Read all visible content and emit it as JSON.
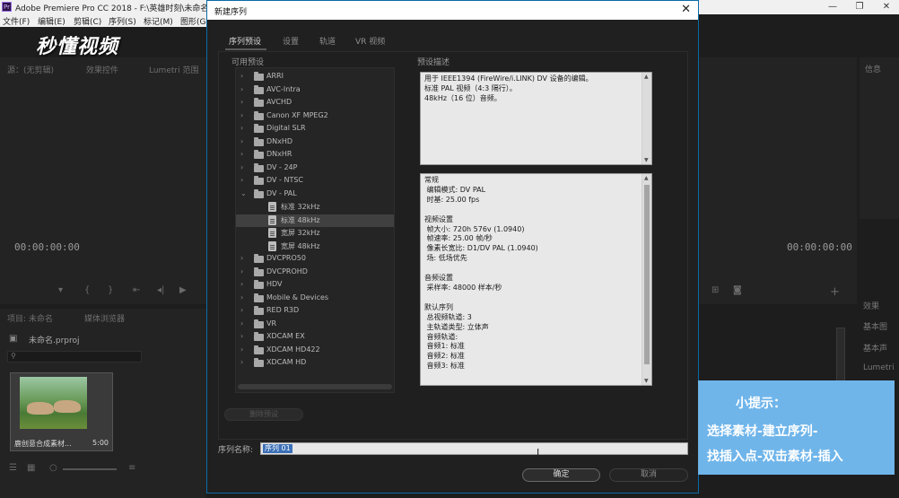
{
  "app": {
    "title": "Adobe Premiere Pro CC 2018 - F:\\英雄时刻\\未命名",
    "logo": "Pr",
    "menu": [
      "文件(F)",
      "编辑(E)",
      "剪辑(C)",
      "序列(S)",
      "标记(M)",
      "图形(G"
    ],
    "window_controls": [
      "—",
      "❐",
      "✕"
    ]
  },
  "watermark": "秒懂视频",
  "left_panels": {
    "source_tab": "源：(无剪辑)",
    "effects_tab": "效果控件",
    "lumetri_tab": "Lumetri 范围",
    "timecode_left": "00:00:00:00",
    "timecode_right": "00:00:00:00",
    "project_tab": "项目: 未命名",
    "media_browser_tab": "媒体浏览器",
    "project_file": "未命名.prproj",
    "clip_name": "鹿创意合成素材...",
    "clip_duration": "5:00"
  },
  "right_panels": {
    "items": [
      "信息",
      "效果",
      "基本图",
      "基本声",
      "Lumetri"
    ]
  },
  "dialog": {
    "title": "新建序列",
    "close": "✕",
    "tabs": [
      "序列预设",
      "设置",
      "轨道",
      "VR 视频"
    ],
    "available_presets_label": "可用预设",
    "preset_desc_label": "预设描述",
    "tree": [
      {
        "label": "ARRI",
        "type": "folder",
        "expanded": false
      },
      {
        "label": "AVC-Intra",
        "type": "folder",
        "expanded": false
      },
      {
        "label": "AVCHD",
        "type": "folder",
        "expanded": false
      },
      {
        "label": "Canon XF MPEG2",
        "type": "folder",
        "expanded": false
      },
      {
        "label": "Digital SLR",
        "type": "folder",
        "expanded": false
      },
      {
        "label": "DNxHD",
        "type": "folder",
        "expanded": false
      },
      {
        "label": "DNxHR",
        "type": "folder",
        "expanded": false
      },
      {
        "label": "DV - 24P",
        "type": "folder",
        "expanded": false
      },
      {
        "label": "DV - NTSC",
        "type": "folder",
        "expanded": false
      },
      {
        "label": "DV - PAL",
        "type": "folder",
        "expanded": true
      },
      {
        "label": "标准 32kHz",
        "type": "file"
      },
      {
        "label": "标准 48kHz",
        "type": "file",
        "selected": true
      },
      {
        "label": "宽屏 32kHz",
        "type": "file"
      },
      {
        "label": "宽屏 48kHz",
        "type": "file"
      },
      {
        "label": "DVCPRO50",
        "type": "folder",
        "expanded": false
      },
      {
        "label": "DVCPROHD",
        "type": "folder",
        "expanded": false
      },
      {
        "label": "HDV",
        "type": "folder",
        "expanded": false
      },
      {
        "label": "Mobile & Devices",
        "type": "folder",
        "expanded": false
      },
      {
        "label": "RED R3D",
        "type": "folder",
        "expanded": false
      },
      {
        "label": "VR",
        "type": "folder",
        "expanded": false
      },
      {
        "label": "XDCAM EX",
        "type": "folder",
        "expanded": false
      },
      {
        "label": "XDCAM HD422",
        "type": "folder",
        "expanded": false
      },
      {
        "label": "XDCAM HD",
        "type": "folder",
        "expanded": false
      }
    ],
    "description": "用于 IEEE1394 (FireWire/i.LINK) DV 设备的编辑。\n标准 PAL 视频（4:3 隔行）。\n48kHz（16 位）音频。",
    "details": "常规\n 编辑模式: DV PAL\n 时基: 25.00 fps\n\n视频设置\n 帧大小: 720h 576v (1.0940)\n 帧速率: 25.00 帧/秒\n 像素长宽比: D1/DV PAL (1.0940)\n 场: 低场优先\n\n音频设置\n 采样率: 48000 样本/秒\n\n默认序列\n 总视频轨道: 3\n 主轨道类型: 立体声\n 音频轨道:\n 音频1: 标准\n 音频2: 标准\n 音频3: 标准",
    "delete_preset": "删除预设",
    "sequence_name_label": "序列名称:",
    "sequence_name_value": "序列 01",
    "ok": "确定",
    "cancel": "取消"
  },
  "tip": {
    "title": "小提示：",
    "lines": [
      "选择素材-建立序列-",
      "找插入点-双击素材-插入"
    ]
  },
  "colors": {
    "tip_bg": "#6fb5ea",
    "dialog_border": "#0b6aa6",
    "selection": "#3b6fb6"
  }
}
